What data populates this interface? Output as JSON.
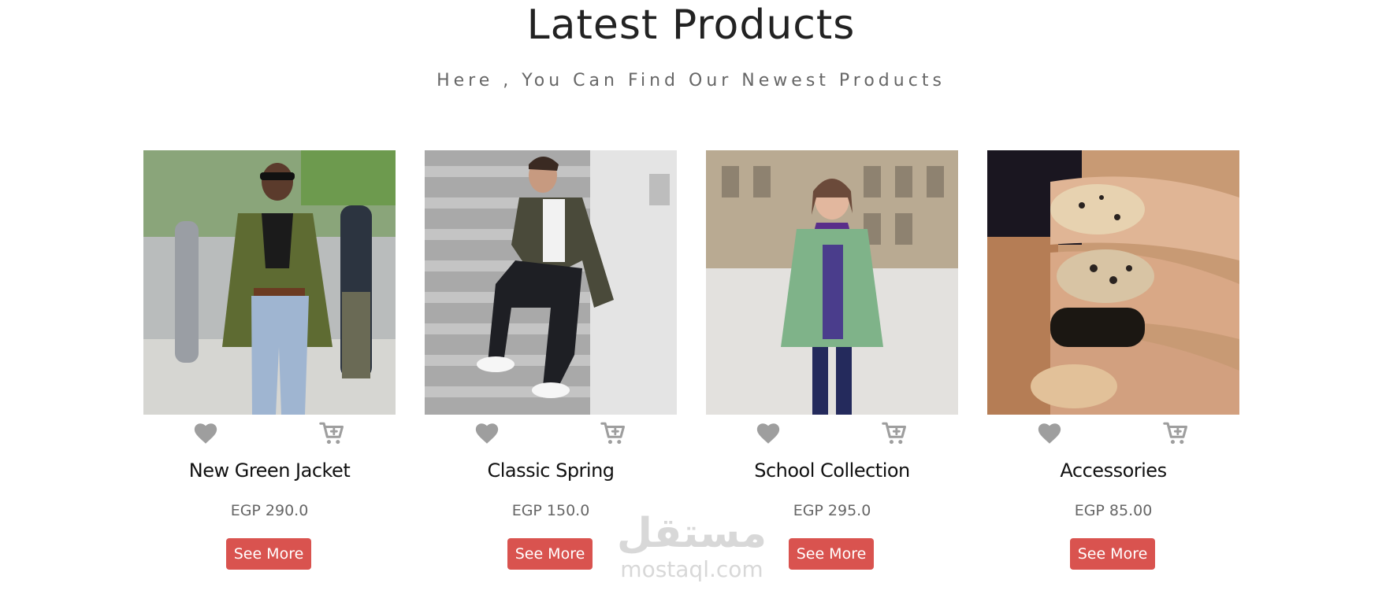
{
  "header": {
    "title": "Latest Products",
    "subtitle": "Here , You Can Find Our Newest Products"
  },
  "products": [
    {
      "name": "New Green Jacket",
      "price": "EGP 290.0",
      "button_label": "See More",
      "image": "woman-green-blazer-photo"
    },
    {
      "name": "Classic Spring",
      "price": "EGP 150.0",
      "button_label": "See More",
      "image": "man-camo-jacket-stairs-photo"
    },
    {
      "name": "School Collection",
      "price": "EGP 295.0",
      "button_label": "See More",
      "image": "girl-green-coat-street-photo"
    },
    {
      "name": "Accessories",
      "price": "EGP 85.00",
      "button_label": "See More",
      "image": "gold-glitter-nails-photo"
    }
  ],
  "icons": {
    "favorite": "heart-icon",
    "cart": "cart-plus-icon"
  },
  "colors": {
    "accent": "#d9534f",
    "icon": "#9e9e9e",
    "title": "#222222",
    "muted": "#666666"
  },
  "watermark": {
    "arabic": "مستقل",
    "latin": "mostaql.com"
  }
}
